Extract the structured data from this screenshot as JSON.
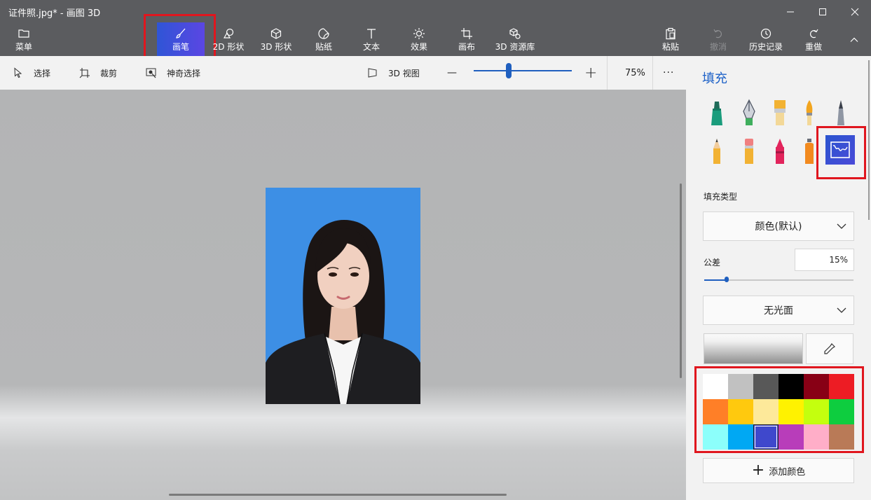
{
  "window": {
    "title": "证件照.jpg* - 画图 3D"
  },
  "ribbon": {
    "menu": "菜单",
    "brushes": "画笔",
    "shapes2d": "2D 形状",
    "shapes3d": "3D 形状",
    "stickers": "贴纸",
    "text": "文本",
    "effects": "效果",
    "canvas": "画布",
    "library3d": "3D 资源库",
    "paste": "粘贴",
    "undo": "撤消",
    "history": "历史记录",
    "redo": "重做"
  },
  "toolbar": {
    "select": "选择",
    "crop": "裁剪",
    "magic_select": "神奇选择",
    "view3d": "3D 视图",
    "zoom_minus": "—",
    "zoom_plus": "+",
    "zoom_level": "75%",
    "more": "···"
  },
  "panel": {
    "title": "填充",
    "fill_type_label": "填充类型",
    "fill_type_value": "颜色(默认)",
    "tolerance_label": "公差",
    "tolerance_value": "15%",
    "tolerance_fraction": 0.15,
    "finish_value": "无光面",
    "add_color": "添加颜色",
    "palette": [
      "#ffffff",
      "#c1c1c1",
      "#585858",
      "#000000",
      "#880015",
      "#ed1c24",
      "#ff7f27",
      "#ffc90e",
      "#fde99a",
      "#fff200",
      "#c4ff0e",
      "#0ecd3f",
      "#8cfffb",
      "#00a8f3",
      "#3f48cc",
      "#b83dba",
      "#ffaec8",
      "#b97a57"
    ],
    "selected_color": "#3f48cc"
  },
  "colors": {
    "accent": "#1e62c8",
    "highlight_box": "#e0161e",
    "photo_background": "#3d8fe5"
  }
}
